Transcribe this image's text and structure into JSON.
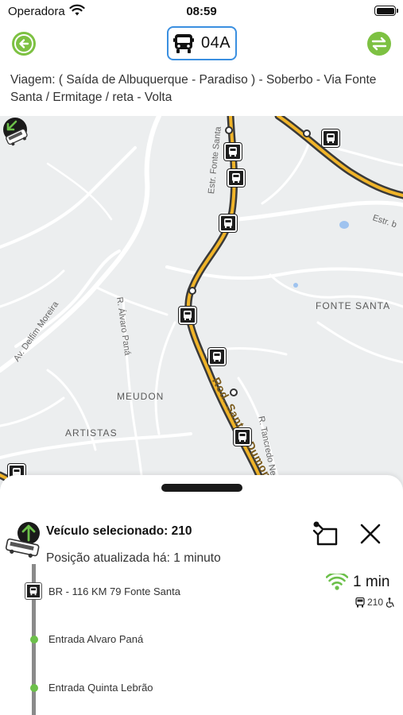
{
  "status_bar": {
    "carrier": "Operadora",
    "time": "08:59"
  },
  "header": {
    "route_code": "04A",
    "trip_description": "Viagem: ( Saída de Albuquerque - Paradiso ) - Soberbo - Via Fonte Santa / Ermitage / reta - Volta",
    "accent_color": "#7dc142",
    "chip_border_color": "#3a8fe0"
  },
  "map": {
    "labels": {
      "fonte_santa": "FONTE SANTA",
      "meudon": "MEUDON",
      "artistas": "ARTISTAS"
    },
    "streets": {
      "estr_fonte_santa": "Estr. Fonte Santa",
      "estr_b": "Estr. b",
      "r_alvaro_pana": "R. Álvaro Paná",
      "av_delfim_moreira": "Av. Delfim Moreira",
      "r_tancredo_neves": "R. Tancredo Neves",
      "rod_santos_dumont": "Rod. Santos Dumont"
    },
    "route_color": "#f0b429"
  },
  "sheet": {
    "vehicle_title": "Veículo selecionado: 210",
    "updated_text": "Posição atualizada há: 1 minuto",
    "eta": "1 min",
    "eta_vehicle": "210",
    "stops": [
      {
        "label": "BR - 116 KM 79 Fonte Santa"
      },
      {
        "label": "Entrada Alvaro Paná"
      },
      {
        "label": "Entrada Quinta Lebrão"
      }
    ],
    "timeline_dot_color": "#6cc04a"
  }
}
